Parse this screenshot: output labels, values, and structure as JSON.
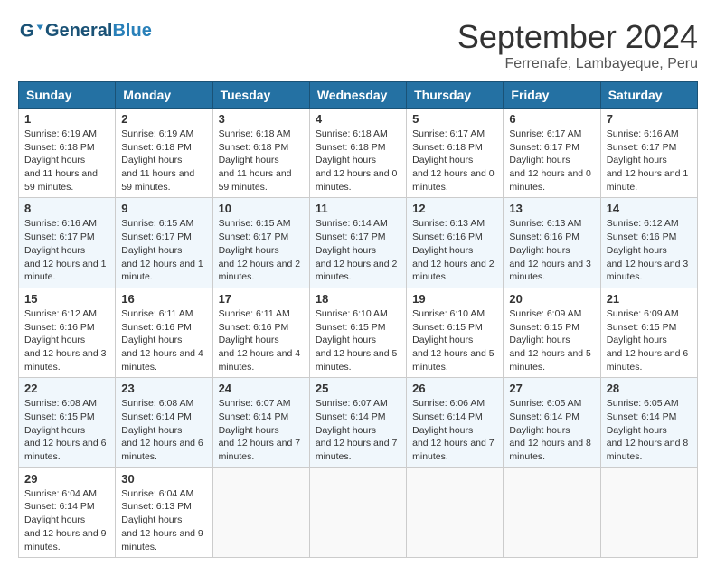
{
  "header": {
    "logo_general": "General",
    "logo_blue": "Blue",
    "month_title": "September 2024",
    "subtitle": "Ferrenafe, Lambayeque, Peru"
  },
  "weekdays": [
    "Sunday",
    "Monday",
    "Tuesday",
    "Wednesday",
    "Thursday",
    "Friday",
    "Saturday"
  ],
  "weeks": [
    [
      {
        "day": "1",
        "sunrise": "6:19 AM",
        "sunset": "6:18 PM",
        "daylight": "11 hours and 59 minutes."
      },
      {
        "day": "2",
        "sunrise": "6:19 AM",
        "sunset": "6:18 PM",
        "daylight": "11 hours and 59 minutes."
      },
      {
        "day": "3",
        "sunrise": "6:18 AM",
        "sunset": "6:18 PM",
        "daylight": "11 hours and 59 minutes."
      },
      {
        "day": "4",
        "sunrise": "6:18 AM",
        "sunset": "6:18 PM",
        "daylight": "12 hours and 0 minutes."
      },
      {
        "day": "5",
        "sunrise": "6:17 AM",
        "sunset": "6:18 PM",
        "daylight": "12 hours and 0 minutes."
      },
      {
        "day": "6",
        "sunrise": "6:17 AM",
        "sunset": "6:17 PM",
        "daylight": "12 hours and 0 minutes."
      },
      {
        "day": "7",
        "sunrise": "6:16 AM",
        "sunset": "6:17 PM",
        "daylight": "12 hours and 1 minute."
      }
    ],
    [
      {
        "day": "8",
        "sunrise": "6:16 AM",
        "sunset": "6:17 PM",
        "daylight": "12 hours and 1 minute."
      },
      {
        "day": "9",
        "sunrise": "6:15 AM",
        "sunset": "6:17 PM",
        "daylight": "12 hours and 1 minute."
      },
      {
        "day": "10",
        "sunrise": "6:15 AM",
        "sunset": "6:17 PM",
        "daylight": "12 hours and 2 minutes."
      },
      {
        "day": "11",
        "sunrise": "6:14 AM",
        "sunset": "6:17 PM",
        "daylight": "12 hours and 2 minutes."
      },
      {
        "day": "12",
        "sunrise": "6:13 AM",
        "sunset": "6:16 PM",
        "daylight": "12 hours and 2 minutes."
      },
      {
        "day": "13",
        "sunrise": "6:13 AM",
        "sunset": "6:16 PM",
        "daylight": "12 hours and 3 minutes."
      },
      {
        "day": "14",
        "sunrise": "6:12 AM",
        "sunset": "6:16 PM",
        "daylight": "12 hours and 3 minutes."
      }
    ],
    [
      {
        "day": "15",
        "sunrise": "6:12 AM",
        "sunset": "6:16 PM",
        "daylight": "12 hours and 3 minutes."
      },
      {
        "day": "16",
        "sunrise": "6:11 AM",
        "sunset": "6:16 PM",
        "daylight": "12 hours and 4 minutes."
      },
      {
        "day": "17",
        "sunrise": "6:11 AM",
        "sunset": "6:16 PM",
        "daylight": "12 hours and 4 minutes."
      },
      {
        "day": "18",
        "sunrise": "6:10 AM",
        "sunset": "6:15 PM",
        "daylight": "12 hours and 5 minutes."
      },
      {
        "day": "19",
        "sunrise": "6:10 AM",
        "sunset": "6:15 PM",
        "daylight": "12 hours and 5 minutes."
      },
      {
        "day": "20",
        "sunrise": "6:09 AM",
        "sunset": "6:15 PM",
        "daylight": "12 hours and 5 minutes."
      },
      {
        "day": "21",
        "sunrise": "6:09 AM",
        "sunset": "6:15 PM",
        "daylight": "12 hours and 6 minutes."
      }
    ],
    [
      {
        "day": "22",
        "sunrise": "6:08 AM",
        "sunset": "6:15 PM",
        "daylight": "12 hours and 6 minutes."
      },
      {
        "day": "23",
        "sunrise": "6:08 AM",
        "sunset": "6:14 PM",
        "daylight": "12 hours and 6 minutes."
      },
      {
        "day": "24",
        "sunrise": "6:07 AM",
        "sunset": "6:14 PM",
        "daylight": "12 hours and 7 minutes."
      },
      {
        "day": "25",
        "sunrise": "6:07 AM",
        "sunset": "6:14 PM",
        "daylight": "12 hours and 7 minutes."
      },
      {
        "day": "26",
        "sunrise": "6:06 AM",
        "sunset": "6:14 PM",
        "daylight": "12 hours and 7 minutes."
      },
      {
        "day": "27",
        "sunrise": "6:05 AM",
        "sunset": "6:14 PM",
        "daylight": "12 hours and 8 minutes."
      },
      {
        "day": "28",
        "sunrise": "6:05 AM",
        "sunset": "6:14 PM",
        "daylight": "12 hours and 8 minutes."
      }
    ],
    [
      {
        "day": "29",
        "sunrise": "6:04 AM",
        "sunset": "6:14 PM",
        "daylight": "12 hours and 9 minutes."
      },
      {
        "day": "30",
        "sunrise": "6:04 AM",
        "sunset": "6:13 PM",
        "daylight": "12 hours and 9 minutes."
      },
      null,
      null,
      null,
      null,
      null
    ]
  ]
}
